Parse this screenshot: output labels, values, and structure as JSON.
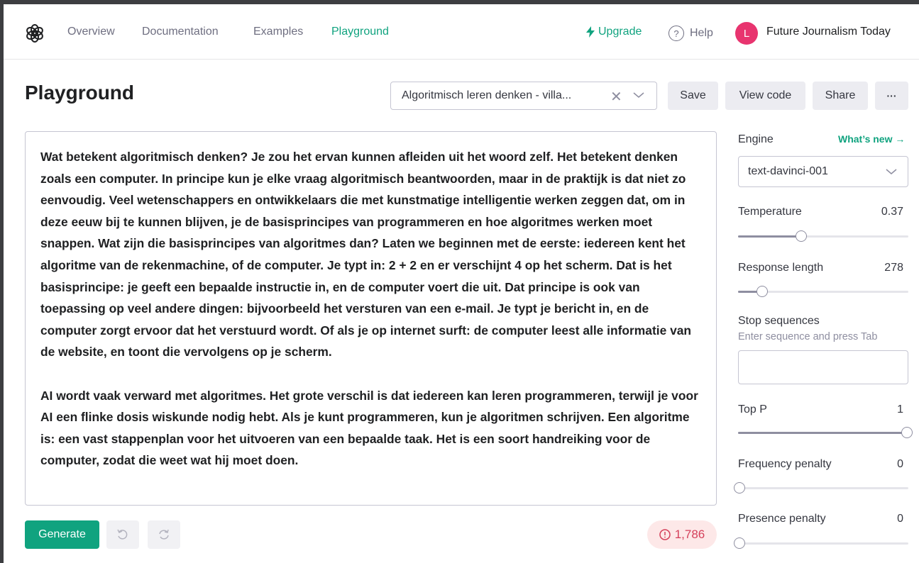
{
  "nav": {
    "links": [
      {
        "label": "Overview",
        "active": false
      },
      {
        "label": "Documentation",
        "active": false
      },
      {
        "label": "Examples",
        "active": false
      },
      {
        "label": "Playground",
        "active": true
      }
    ],
    "upgrade_label": "Upgrade",
    "help_label": "Help",
    "avatar_initial": "L",
    "org_name": "Future Journalism Today"
  },
  "page": {
    "title": "Playground",
    "preset_value": "Algoritmisch leren denken - villa...",
    "save_label": "Save",
    "view_code_label": "View code",
    "share_label": "Share",
    "more_label": "···"
  },
  "editor": {
    "paragraphs": [
      "Wat betekent algoritmisch denken?  Je zou het ervan kunnen afleiden uit het woord zelf. Het betekent denken zoals een computer. In principe kun je elke vraag algoritmisch beantwoorden, maar in de praktijk is dat niet zo eenvoudig. Veel wetenschappers en ontwikkelaars die met kunstmatige intelligentie werken zeggen dat, om in deze eeuw bij te kunnen blijven, je de basisprincipes van programmeren en hoe algoritmes werken moet snappen. Wat zijn die basisprincipes van algoritmes dan? Laten we beginnen met de eerste: iedereen kent het algoritme van de rekenmachine, of de computer. Je typt in: 2 + 2 en er verschijnt 4 op het scherm. Dat is het basisprincipe: je geeft een bepaalde instructie in, en de computer voert die uit. Dat principe is ook van toepassing op veel andere dingen: bijvoorbeeld het versturen van een e-mail. Je typt je bericht in, en de computer zorgt ervoor dat het verstuurd wordt. Of als je op internet surft: de computer leest alle informatie van de website, en toont die vervolgens op je scherm.",
      "AI wordt vaak verward met algoritmes. Het grote verschil is dat iedereen kan leren programmeren, terwijl je voor AI een flinke dosis wiskunde nodig hebt. Als je kunt programmeren, kun je algoritmen schrijven. Een algoritme is: een vast stappenplan voor het uitvoeren van een bepaalde taak. Het is een soort handreiking voor de computer, zodat die weet wat hij moet doen."
    ]
  },
  "actions": {
    "generate_label": "Generate",
    "token_count": "1,786"
  },
  "settings": {
    "engine_label": "Engine",
    "whats_new_label": "What’s new →",
    "engine_value": "text-davinci-001",
    "temperature": {
      "label": "Temperature",
      "value": "0.37",
      "fraction": 0.37
    },
    "response_length": {
      "label": "Response length",
      "value": "278",
      "fraction": 0.14
    },
    "stop_sequences": {
      "label": "Stop sequences",
      "hint": "Enter sequence and press Tab"
    },
    "top_p": {
      "label": "Top P",
      "value": "1",
      "fraction": 1
    },
    "frequency_penalty": {
      "label": "Frequency penalty",
      "value": "0",
      "fraction": 0
    },
    "presence_penalty": {
      "label": "Presence penalty",
      "value": "0",
      "fraction": 0
    }
  },
  "colors": {
    "accent": "#10a37f",
    "avatar": "#e8346f",
    "warning": "#d5405b"
  }
}
